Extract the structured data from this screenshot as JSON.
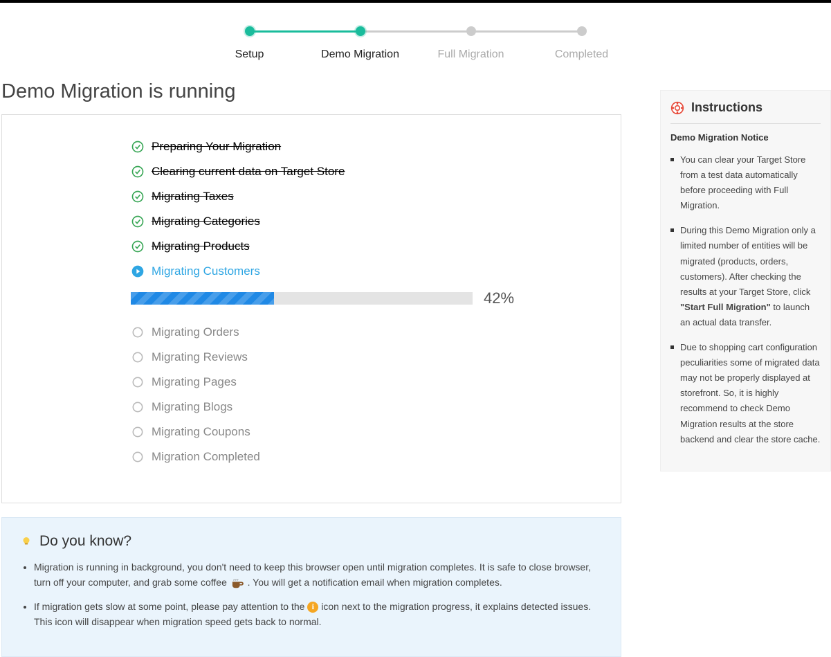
{
  "stepper": {
    "steps": [
      {
        "label": "Setup",
        "active": true
      },
      {
        "label": "Demo Migration",
        "active": true
      },
      {
        "label": "Full Migration",
        "active": false
      },
      {
        "label": "Completed",
        "active": false
      }
    ]
  },
  "page_title": "Demo Migration is running",
  "tasks": [
    {
      "label": "Preparing Your Migration",
      "state": "done"
    },
    {
      "label": "Clearing current data on Target Store",
      "state": "done"
    },
    {
      "label": "Migrating Taxes",
      "state": "done"
    },
    {
      "label": "Migrating Categories",
      "state": "done"
    },
    {
      "label": "Migrating Products",
      "state": "done"
    },
    {
      "label": "Migrating Customers",
      "state": "active"
    },
    {
      "label": "Migrating Orders",
      "state": "pending"
    },
    {
      "label": "Migrating Reviews",
      "state": "pending"
    },
    {
      "label": "Migrating Pages",
      "state": "pending"
    },
    {
      "label": "Migrating Blogs",
      "state": "pending"
    },
    {
      "label": "Migrating Coupons",
      "state": "pending"
    },
    {
      "label": "Migration Completed",
      "state": "pending"
    }
  ],
  "progress": {
    "percent": 42,
    "label": "42%"
  },
  "instructions": {
    "title": "Instructions",
    "subtitle": "Demo Migration Notice",
    "items": [
      {
        "text": "You can clear your Target Store from a test data automatically before proceeding with Full Migration."
      },
      {
        "pre": "During this Demo Migration only a limited number of entities will be migrated (products, orders, customers). After checking the results at your Target Store, click ",
        "bold": "\"Start Full Migration\"",
        "post": " to launch an actual data transfer."
      },
      {
        "text": "Due to shopping cart configuration peculiarities some of migrated data may not be properly displayed at storefront. So, it is highly recommend to check Demo Migration results at the store backend and clear the store cache."
      }
    ]
  },
  "tips": {
    "title": "Do you know?",
    "items": [
      {
        "pre": "Migration is running in background, you don't need to keep this browser open until migration completes. It is safe to close browser, turn off your computer, and grab some coffee ",
        "icon": "coffee",
        "post": " . You will get a notification email when migration completes."
      },
      {
        "pre": "If migration gets slow at some point, please pay attention to the ",
        "icon": "info",
        "post": " icon next to the migration progress, it explains detected issues. This icon will disappear when migration speed gets back to normal."
      }
    ]
  }
}
